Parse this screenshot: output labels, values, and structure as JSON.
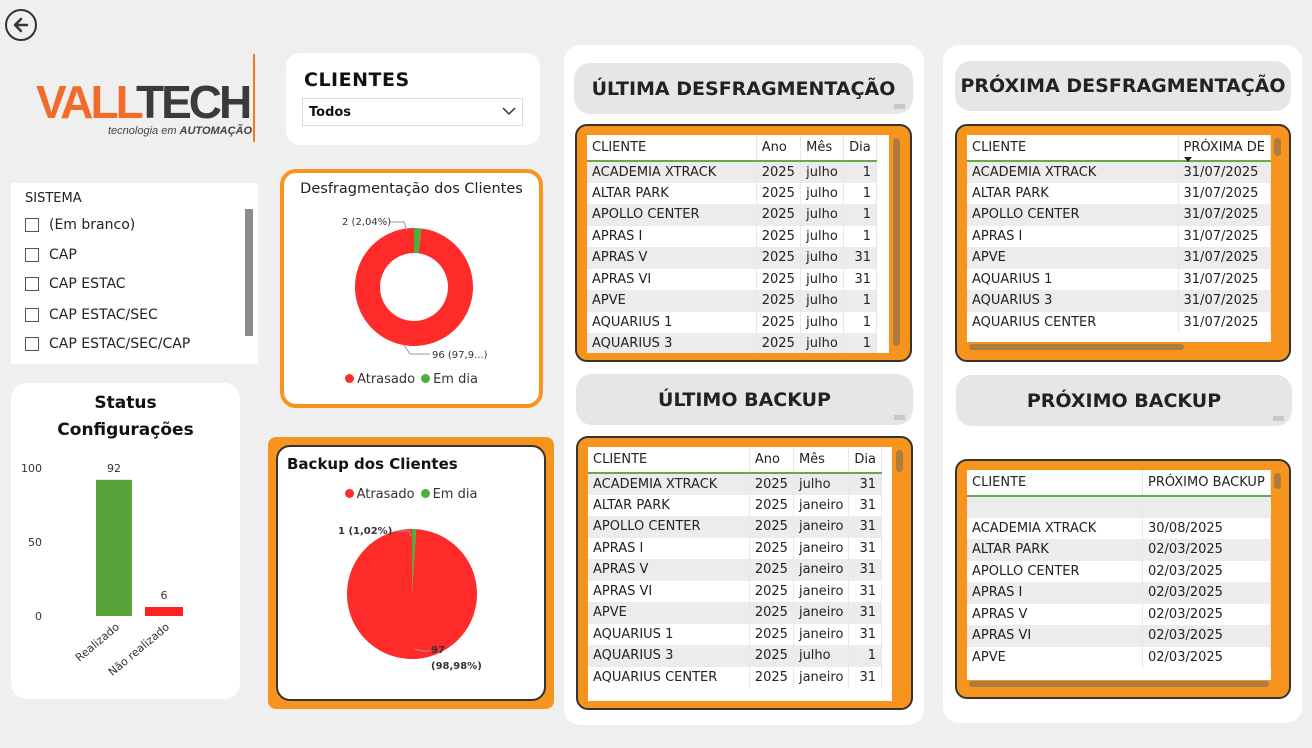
{
  "nav": {
    "back_icon": "arrow-left-circle-icon"
  },
  "logo": {
    "brand_a": "VALL",
    "brand_b": "TECH",
    "tagline_a": "tecnologia em ",
    "tagline_b": "AUTOMAÇÃO"
  },
  "clientes_slicer": {
    "title": "CLIENTES",
    "selected": "Todos"
  },
  "sistema_slicer": {
    "title": "SISTEMA",
    "items": [
      "(Em branco)",
      "CAP",
      "CAP ESTAC",
      "CAP ESTAC/SEC",
      "CAP ESTAC/SEC/CAP"
    ]
  },
  "status": {
    "title_line1": "Status",
    "title_line2": "Configurações",
    "chart_data": {
      "type": "bar",
      "categories": [
        "Realizado",
        "Não realizado"
      ],
      "values": [
        92,
        6
      ],
      "colors": [
        "#5aa33a",
        "#ff2222"
      ],
      "yticks": [
        "100",
        "50",
        "0"
      ],
      "ylim": [
        0,
        100
      ]
    }
  },
  "desfrag_chart": {
    "title": "Desfragmentação dos Clientes",
    "legend": [
      "Atrasado",
      "Em dia"
    ],
    "chart_data": {
      "type": "pie",
      "donut": true,
      "categories": [
        "Atrasado",
        "Em dia"
      ],
      "values": [
        96,
        2
      ],
      "colors": [
        "#ff2a2a",
        "#4caf3a"
      ],
      "labels": [
        "96 (97,9...)",
        "2 (2,04%)"
      ]
    }
  },
  "backup_chart": {
    "title": "Backup dos Clientes",
    "legend": [
      "Atrasado",
      "Em dia"
    ],
    "chart_data": {
      "type": "pie",
      "categories": [
        "Atrasado",
        "Em dia"
      ],
      "values": [
        97,
        1
      ],
      "colors": [
        "#ff2a2a",
        "#4caf3a"
      ],
      "labels": [
        "97",
        "(98,98%)",
        "1 (1,02%)"
      ]
    }
  },
  "ultima_desfrag": {
    "title": "ÚLTIMA DESFRAGMENTAÇÃO",
    "columns": [
      "CLIENTE",
      "Ano",
      "Mês",
      "Dia"
    ],
    "rows": [
      [
        "ACADEMIA XTRACK",
        "2025",
        "julho",
        "1"
      ],
      [
        "ALTAR PARK",
        "2025",
        "julho",
        "1"
      ],
      [
        "APOLLO CENTER",
        "2025",
        "julho",
        "1"
      ],
      [
        "APRAS I",
        "2025",
        "julho",
        "1"
      ],
      [
        "APRAS V",
        "2025",
        "julho",
        "31"
      ],
      [
        "APRAS VI",
        "2025",
        "julho",
        "31"
      ],
      [
        "APVE",
        "2025",
        "julho",
        "1"
      ],
      [
        "AQUARIUS 1",
        "2025",
        "julho",
        "1"
      ],
      [
        "AQUARIUS 3",
        "2025",
        "julho",
        "1"
      ]
    ]
  },
  "ultimo_backup": {
    "title": "ÚLTIMO BACKUP",
    "columns": [
      "CLIENTE",
      "Ano",
      "Mês",
      "Dia"
    ],
    "rows": [
      [
        "ACADEMIA XTRACK",
        "2025",
        "julho",
        "31"
      ],
      [
        "ALTAR PARK",
        "2025",
        "janeiro",
        "31"
      ],
      [
        "APOLLO CENTER",
        "2025",
        "janeiro",
        "31"
      ],
      [
        "APRAS I",
        "2025",
        "janeiro",
        "31"
      ],
      [
        "APRAS V",
        "2025",
        "janeiro",
        "31"
      ],
      [
        "APRAS VI",
        "2025",
        "janeiro",
        "31"
      ],
      [
        "APVE",
        "2025",
        "janeiro",
        "31"
      ],
      [
        "AQUARIUS 1",
        "2025",
        "janeiro",
        "31"
      ],
      [
        "AQUARIUS 3",
        "2025",
        "julho",
        "1"
      ],
      [
        "AQUARIUS CENTER",
        "2025",
        "janeiro",
        "31"
      ]
    ]
  },
  "proxima_desfrag": {
    "title": "PRÓXIMA DESFRAGMENTAÇÃO",
    "columns": [
      "CLIENTE",
      "PRÓXIMA DE"
    ],
    "rows": [
      [
        "ACADEMIA XTRACK",
        "31/07/2025"
      ],
      [
        "ALTAR PARK",
        "31/07/2025"
      ],
      [
        "APOLLO CENTER",
        "31/07/2025"
      ],
      [
        "APRAS I",
        "31/07/2025"
      ],
      [
        "APVE",
        "31/07/2025"
      ],
      [
        "AQUARIUS 1",
        "31/07/2025"
      ],
      [
        "AQUARIUS 3",
        "31/07/2025"
      ],
      [
        "AQUARIUS CENTER",
        "31/07/2025"
      ]
    ]
  },
  "proximo_backup": {
    "title": "PRÓXIMO BACKUP",
    "columns": [
      "CLIENTE",
      "PRÓXIMO BACKUP"
    ],
    "rows": [
      [
        "",
        ""
      ],
      [
        "ACADEMIA XTRACK",
        "30/08/2025"
      ],
      [
        "ALTAR PARK",
        "02/03/2025"
      ],
      [
        "APOLLO CENTER",
        "02/03/2025"
      ],
      [
        "APRAS I",
        "02/03/2025"
      ],
      [
        "APRAS V",
        "02/03/2025"
      ],
      [
        "APRAS VI",
        "02/03/2025"
      ],
      [
        "APVE",
        "02/03/2025"
      ]
    ]
  }
}
